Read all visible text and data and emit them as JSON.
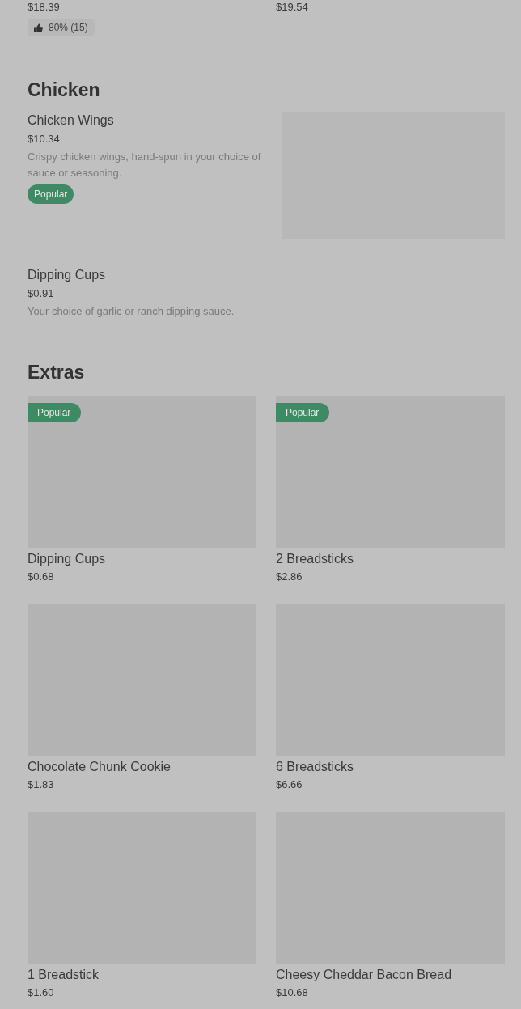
{
  "top_items": [
    {
      "price": "$18.39",
      "rating": "80% (15)"
    },
    {
      "price": "$19.54"
    }
  ],
  "sections": [
    {
      "title": "Chicken",
      "kind": "list",
      "items": [
        {
          "name": "Chicken Wings",
          "price": "$10.34",
          "description": "Crispy chicken wings, hand-spun in your choice of sauce or seasoning.",
          "badge": "Popular",
          "image": true
        },
        {
          "name": "Dipping Cups",
          "price": "$0.91",
          "description": "Your choice of garlic or ranch dipping sauce."
        }
      ]
    },
    {
      "title": "Extras",
      "kind": "grid",
      "items": [
        {
          "name": "Dipping Cups",
          "price": "$0.68",
          "badge": "Popular",
          "image": true
        },
        {
          "name": "2 Breadsticks",
          "price": "$2.86",
          "badge": "Popular",
          "image": true
        },
        {
          "name": "Chocolate Chunk Cookie",
          "price": "$1.83",
          "image": true
        },
        {
          "name": "6 Breadsticks",
          "price": "$6.66",
          "image": true
        },
        {
          "name": "1 Breadstick",
          "price": "$1.60",
          "image": true
        },
        {
          "name": "Cheesy Cheddar Bacon Bread",
          "price": "$10.68",
          "image": true
        }
      ]
    }
  ]
}
